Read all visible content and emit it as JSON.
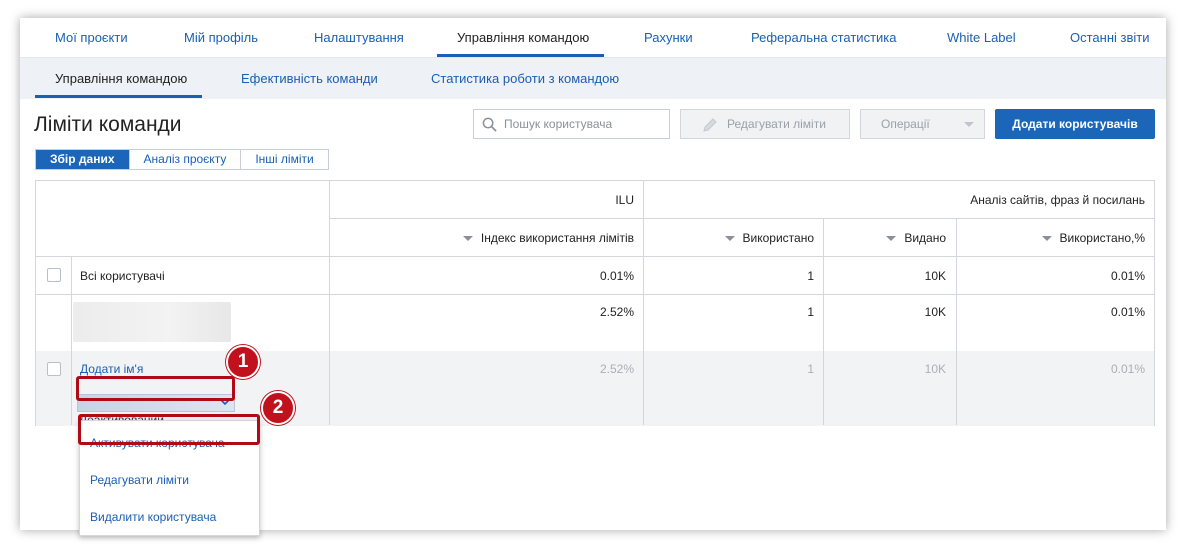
{
  "top_nav": {
    "tabs": [
      {
        "label": "Мої проєкти",
        "active": false
      },
      {
        "label": "Мій профіль",
        "active": false
      },
      {
        "label": "Налаштування",
        "active": false
      },
      {
        "label": "Управління командою",
        "active": true
      },
      {
        "label": "Рахунки",
        "active": false
      },
      {
        "label": "Реферальна статистика",
        "active": false
      },
      {
        "label": "White Label",
        "active": false
      },
      {
        "label": "Останні звіти",
        "active": false
      }
    ]
  },
  "sub_nav": {
    "tabs": [
      {
        "label": "Управління командою",
        "active": true
      },
      {
        "label": "Ефективність команди",
        "active": false
      },
      {
        "label": "Статистика роботи з командою",
        "active": false
      }
    ]
  },
  "page": {
    "title": "Ліміти команди"
  },
  "toolbar": {
    "search_placeholder": "Пошук користувача",
    "edit_limits": "Редагувати ліміти",
    "operations": "Операції",
    "add_users": "Додати користувачів"
  },
  "segments": [
    {
      "label": "Збір даних",
      "active": true
    },
    {
      "label": "Аналіз проєкту",
      "active": false
    },
    {
      "label": "Інші ліміти",
      "active": false
    }
  ],
  "table": {
    "group_headers": [
      "ILU",
      "Аналіз сайтів, фраз й посилань"
    ],
    "columns": [
      "Індекс використання лімітів",
      "Використано",
      "Видано",
      "Використано,%"
    ],
    "rows": [
      {
        "name": "Всі користувачі",
        "values": [
          "0.01%",
          "1",
          "10K",
          "0.01%"
        ]
      },
      {
        "name": "",
        "values": [
          "2.52%",
          "1",
          "10K",
          "0.01%"
        ]
      },
      {
        "name": "Додати ім'я",
        "values": [
          "2.52%",
          "1",
          "10K",
          "0.01%"
        ]
      }
    ],
    "status_partial": "Деактивований"
  },
  "dropdown": {
    "items": [
      "Активувати користувача",
      "Редагувати ліміти",
      "Видалити користувача"
    ]
  },
  "markers": [
    "1",
    "2"
  ],
  "colors": {
    "accent": "#1b66b8",
    "annotation": "#c0111c",
    "link": "#1a5fb4"
  }
}
